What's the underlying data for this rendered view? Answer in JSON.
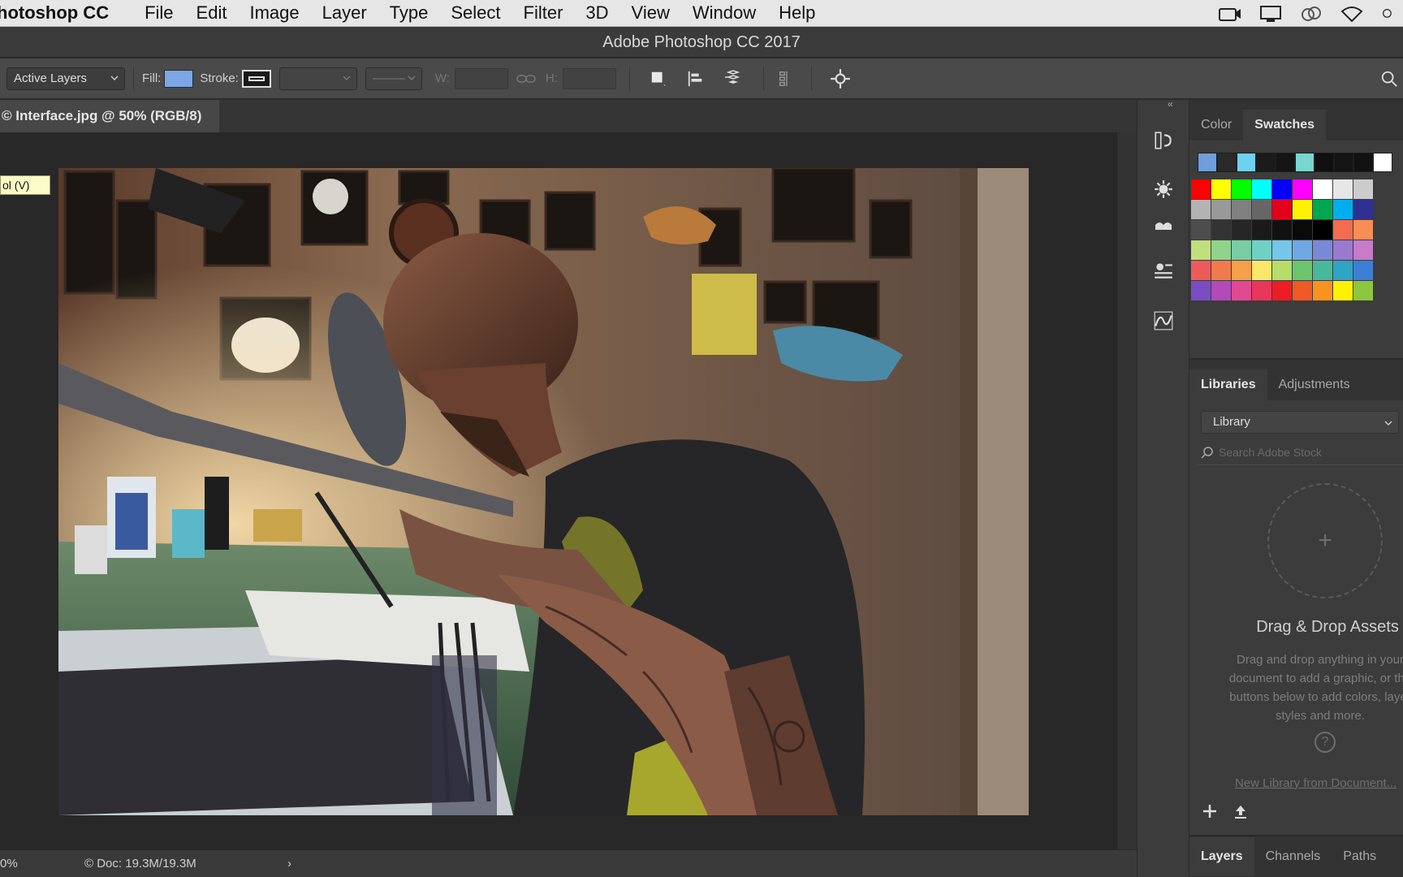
{
  "menubar": {
    "app_name": "hotoshop CC",
    "items": [
      "File",
      "Edit",
      "Image",
      "Layer",
      "Type",
      "Select",
      "Filter",
      "3D",
      "View",
      "Window",
      "Help"
    ],
    "status_icons": [
      "camera-icon",
      "display-icon",
      "creative-cloud-icon",
      "wifi-icon",
      "user-icon"
    ]
  },
  "titlebar": {
    "title": "Adobe Photoshop CC 2017"
  },
  "options": {
    "sample_select": "Active Layers",
    "fill_label": "Fill:",
    "fill_color": "#7aa6e8",
    "stroke_label": "Stroke:",
    "w_label": "W:",
    "h_label": "H:"
  },
  "document": {
    "tab_title": "© Interface.jpg @ 50% (RGB/8)",
    "tooltip": "ol (V)"
  },
  "statusbar": {
    "zoom": "0%",
    "doc": "© Doc: 19.3M/19.3M",
    "arrow": "›"
  },
  "panels": {
    "color_tabs": [
      "Color",
      "Swatches"
    ],
    "recent_swatches": [
      "#6f9edc",
      "#2a2a2a",
      "#6fd1ee",
      "#1b1b1b",
      "#151515",
      "#77d6cf",
      "#101010",
      "#141414",
      "#121212",
      "#ffffff"
    ],
    "swatch_rows": [
      [
        "#ff0000",
        "#ffff00",
        "#00ff00",
        "#00ffff",
        "#0000ff",
        "#ff00ff",
        "#ffffff",
        "#e6e6e6",
        "#cccccc"
      ],
      [
        "#b3b3b3",
        "#999999",
        "#808080",
        "#666666",
        "#e3001b",
        "#fff200",
        "#00a651",
        "#00aeef",
        "#2e3192"
      ],
      [
        "#4d4d4d",
        "#333333",
        "#262626",
        "#1a1a1a",
        "#111111",
        "#0a0a0a",
        "#000000",
        "#f26c4f",
        "#f68e56"
      ],
      [
        "#bfe07a",
        "#8fd48a",
        "#7acca4",
        "#6fd0c6",
        "#74c7e8",
        "#6ea9e6",
        "#7a88d8",
        "#9b79cf",
        "#c77bc9"
      ],
      [
        "#ee5a5a",
        "#f07a4c",
        "#f5a04a",
        "#fbe86a",
        "#b6dc6a",
        "#6cc56c",
        "#48b89a",
        "#2fa4c6",
        "#3d7fd4"
      ],
      [
        "#7a4ec2",
        "#b24ab7",
        "#e04a90",
        "#e8375a",
        "#ec1d24",
        "#f15a24",
        "#f7931e",
        "#fff200",
        "#8dc63f"
      ]
    ],
    "lib_tabs": [
      "Libraries",
      "Adjustments"
    ],
    "library_select": "Library",
    "search_placeholder": "Search Adobe Stock",
    "drag_title": "Drag & Drop Assets",
    "drag_text": "Drag and drop anything in your document to add a graphic, or the buttons below to add colors, layer styles and more.",
    "help_glyph": "?",
    "new_library_link": "New Library from Document...",
    "bottom_tabs": [
      "Layers",
      "Channels",
      "Paths"
    ]
  }
}
